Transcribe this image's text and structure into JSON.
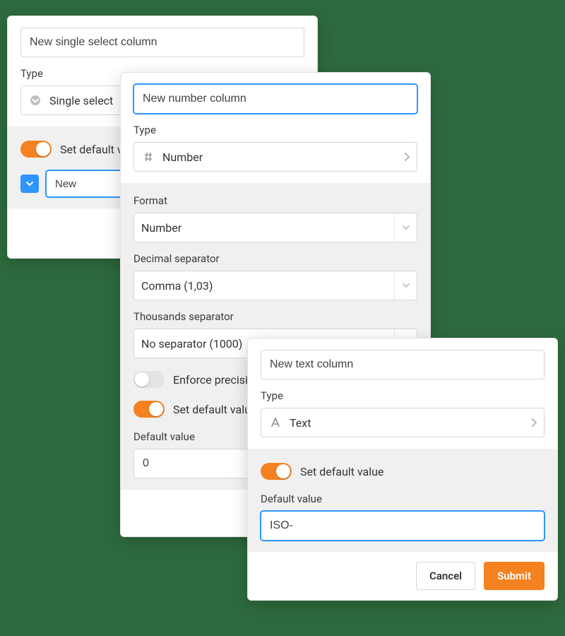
{
  "panel_single": {
    "name_value": "New single select column",
    "type_label": "Type",
    "type_value": "Single select",
    "set_default_label": "Set default value",
    "set_default_on": true,
    "tag_value": "New"
  },
  "panel_number": {
    "name_value": "New number column",
    "type_label": "Type",
    "type_value": "Number",
    "format_label": "Format",
    "format_value": "Number",
    "decimal_label": "Decimal separator",
    "decimal_value": "Comma (1,03)",
    "thousands_label": "Thousands separator",
    "thousands_value": "No separator (1000)",
    "enforce_label": "Enforce precision",
    "enforce_on": false,
    "set_default_label": "Set default value",
    "set_default_on": true,
    "default_label": "Default value",
    "default_value": "0"
  },
  "panel_text": {
    "name_value": "New text column",
    "type_label": "Type",
    "type_value": "Text",
    "set_default_label": "Set default value",
    "set_default_on": true,
    "default_label": "Default value",
    "default_value": "ISO-",
    "cancel_label": "Cancel",
    "submit_label": "Submit"
  }
}
